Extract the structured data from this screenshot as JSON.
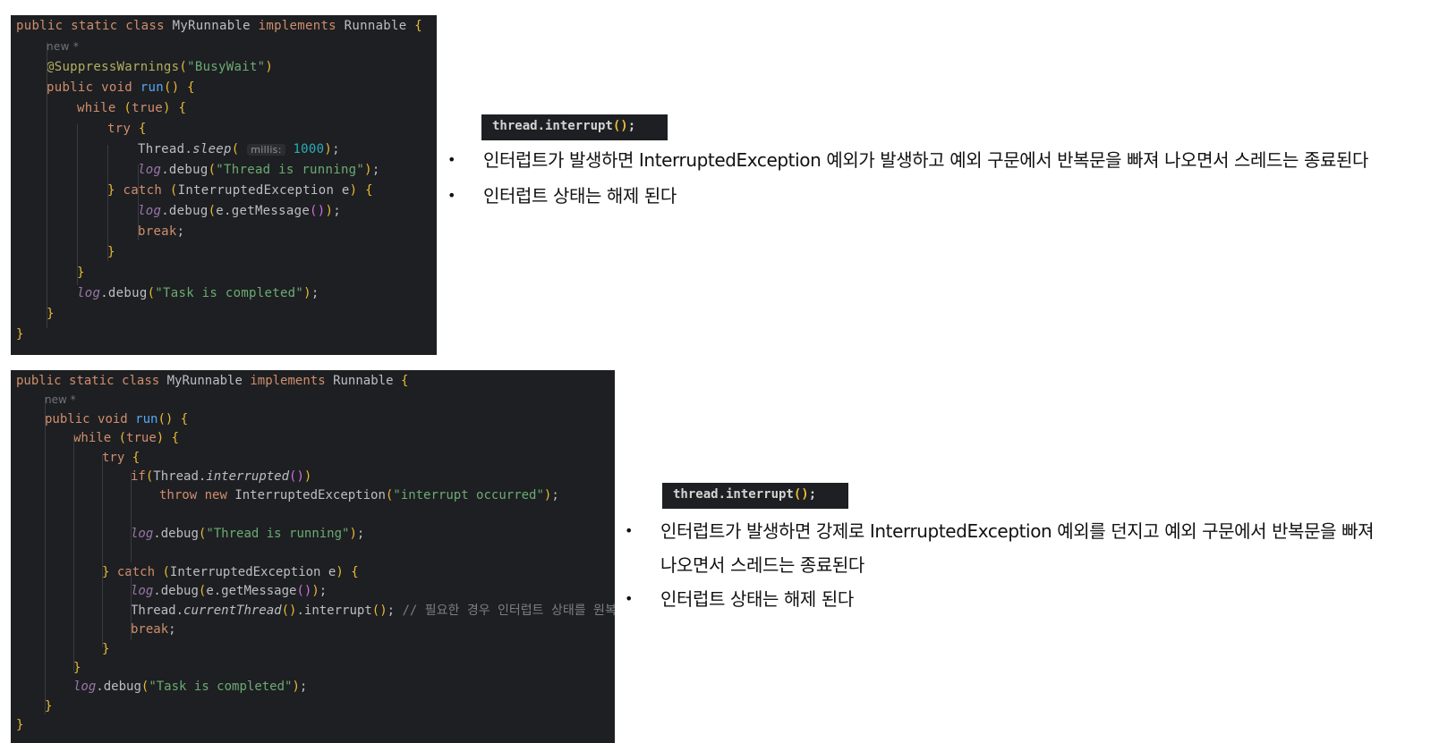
{
  "block1": {
    "code_lines": [
      "public static class MyRunnable implements Runnable {",
      "new *",
      "@SuppressWarnings(\"BusyWait\")",
      "public void run() {",
      "while (true) {",
      "try {",
      "Thread.sleep( millis: 1000);",
      "log.debug(\"Thread is running\");",
      "} catch (InterruptedException e) {",
      "log.debug(e.getMessage());",
      "break;",
      "}",
      "}",
      "log.debug(\"Task is completed\");",
      "}",
      "}"
    ],
    "snippet": "thread.interrupt();",
    "bullets": [
      "인터럽트가 발생하면 InterruptedException 예외가 발생하고 예외 구문에서 반복문을 빠져 나오면서 스레드는 종료된다",
      "인터럽트 상태는 해제 된다"
    ]
  },
  "block2": {
    "code_lines": [
      "public static class MyRunnable implements Runnable {",
      "new *",
      "public void run() {",
      "while (true) {",
      "try {",
      "if(Thread.interrupted())",
      "throw new InterruptedException(\"interrupt occurred\");",
      "",
      "log.debug(\"Thread is running\");",
      "",
      "} catch (InterruptedException e) {",
      "log.debug(e.getMessage());",
      "Thread.currentThread().interrupt(); // 필요한 경우 인터럽트 상태를 원복한다",
      "break;",
      "}",
      "}",
      "log.debug(\"Task is completed\");",
      "}",
      "}"
    ],
    "snippet": "thread.interrupt();",
    "bullets": [
      "인터럽트가 발생하면 강제로 InterruptedException 예외를 던지고 예외 구문에서 반복문을 빠져",
      "나오면서 스레드는 종료된다",
      "인터럽트 상태는 해제 된다"
    ]
  },
  "colors": {
    "editor_background": "#1e1f22",
    "keyword": "#cf8e6d",
    "string": "#6aab73",
    "method": "#56a8f5",
    "number": "#2aacb8",
    "annotation": "#b3ae60",
    "comment": "#7a7e85"
  },
  "icons": {
    "bullet": "bullet-dot-icon"
  }
}
